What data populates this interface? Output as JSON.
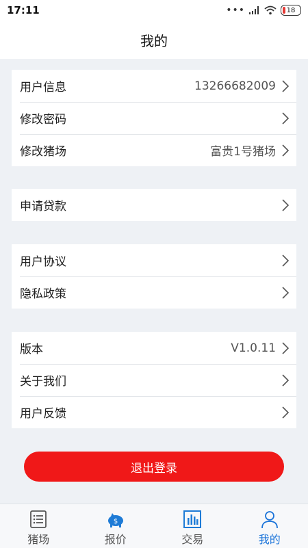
{
  "status_bar": {
    "time": "17:11",
    "battery": "18"
  },
  "header": {
    "title": "我的"
  },
  "groups": [
    {
      "rows": [
        {
          "label": "用户信息",
          "value": "13266682009"
        },
        {
          "label": "修改密码",
          "value": ""
        },
        {
          "label": "修改猪场",
          "value": "富贵1号猪场"
        }
      ]
    },
    {
      "rows": [
        {
          "label": "申请贷款",
          "value": ""
        }
      ]
    },
    {
      "rows": [
        {
          "label": "用户协议",
          "value": ""
        },
        {
          "label": "隐私政策",
          "value": ""
        }
      ]
    },
    {
      "rows": [
        {
          "label": "版本",
          "value": "V1.0.11"
        },
        {
          "label": "关于我们",
          "value": ""
        },
        {
          "label": "用户反馈",
          "value": ""
        }
      ]
    }
  ],
  "logout": {
    "label": "退出登录"
  },
  "bottom_nav": {
    "items": [
      {
        "label": "猪场",
        "icon": "list-icon"
      },
      {
        "label": "报价",
        "icon": "piggy-bank-icon"
      },
      {
        "label": "交易",
        "icon": "bar-chart-icon"
      },
      {
        "label": "我的",
        "icon": "user-icon"
      }
    ],
    "active_index": 3
  },
  "colors": {
    "accent": "#1a73d9",
    "logout": "#f01818",
    "background": "#eef1f5"
  }
}
